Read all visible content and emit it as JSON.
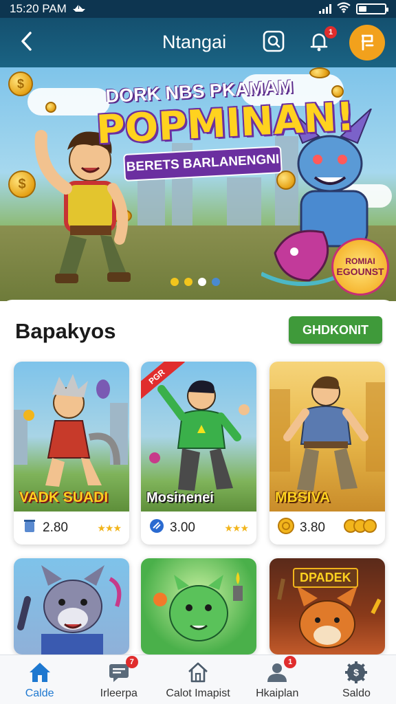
{
  "status_bar": {
    "time": "15:20 PAM"
  },
  "header": {
    "title": "Ntangai",
    "notification_count": "1"
  },
  "banner": {
    "line1": "DORK NBS PKAMAM",
    "line2": "POPMINAN!",
    "ribbon": "BERETS BARLANENGNI",
    "seal_line1": "ROMIAI",
    "seal_line2": "EGOUNST",
    "slides": 4,
    "active_slide": 3
  },
  "section": {
    "title": "Bapakyos",
    "button_label": "GHDKONIT"
  },
  "cards": [
    {
      "title": "VADK SUADI",
      "value": "2.80",
      "tag": ""
    },
    {
      "title": "Mosinenei",
      "value": "3.00",
      "tag": "PGR"
    },
    {
      "title": "MBSIVA",
      "value": "3.80",
      "tag": ""
    }
  ],
  "cards_row2": [
    {
      "title": ""
    },
    {
      "title": ""
    },
    {
      "title": "DPADEK"
    }
  ],
  "nav": [
    {
      "label": "Calde",
      "badge": ""
    },
    {
      "label": "Irleerpa",
      "badge": "7"
    },
    {
      "label": "Calot Imapist",
      "badge": ""
    },
    {
      "label": "Hkaiplan",
      "badge": "1"
    },
    {
      "label": "Saldo",
      "badge": ""
    }
  ],
  "colors": {
    "header": "#14506f",
    "accent": "#1e78d0",
    "button_green": "#3f9a3a",
    "avatar": "#f2a11c"
  }
}
